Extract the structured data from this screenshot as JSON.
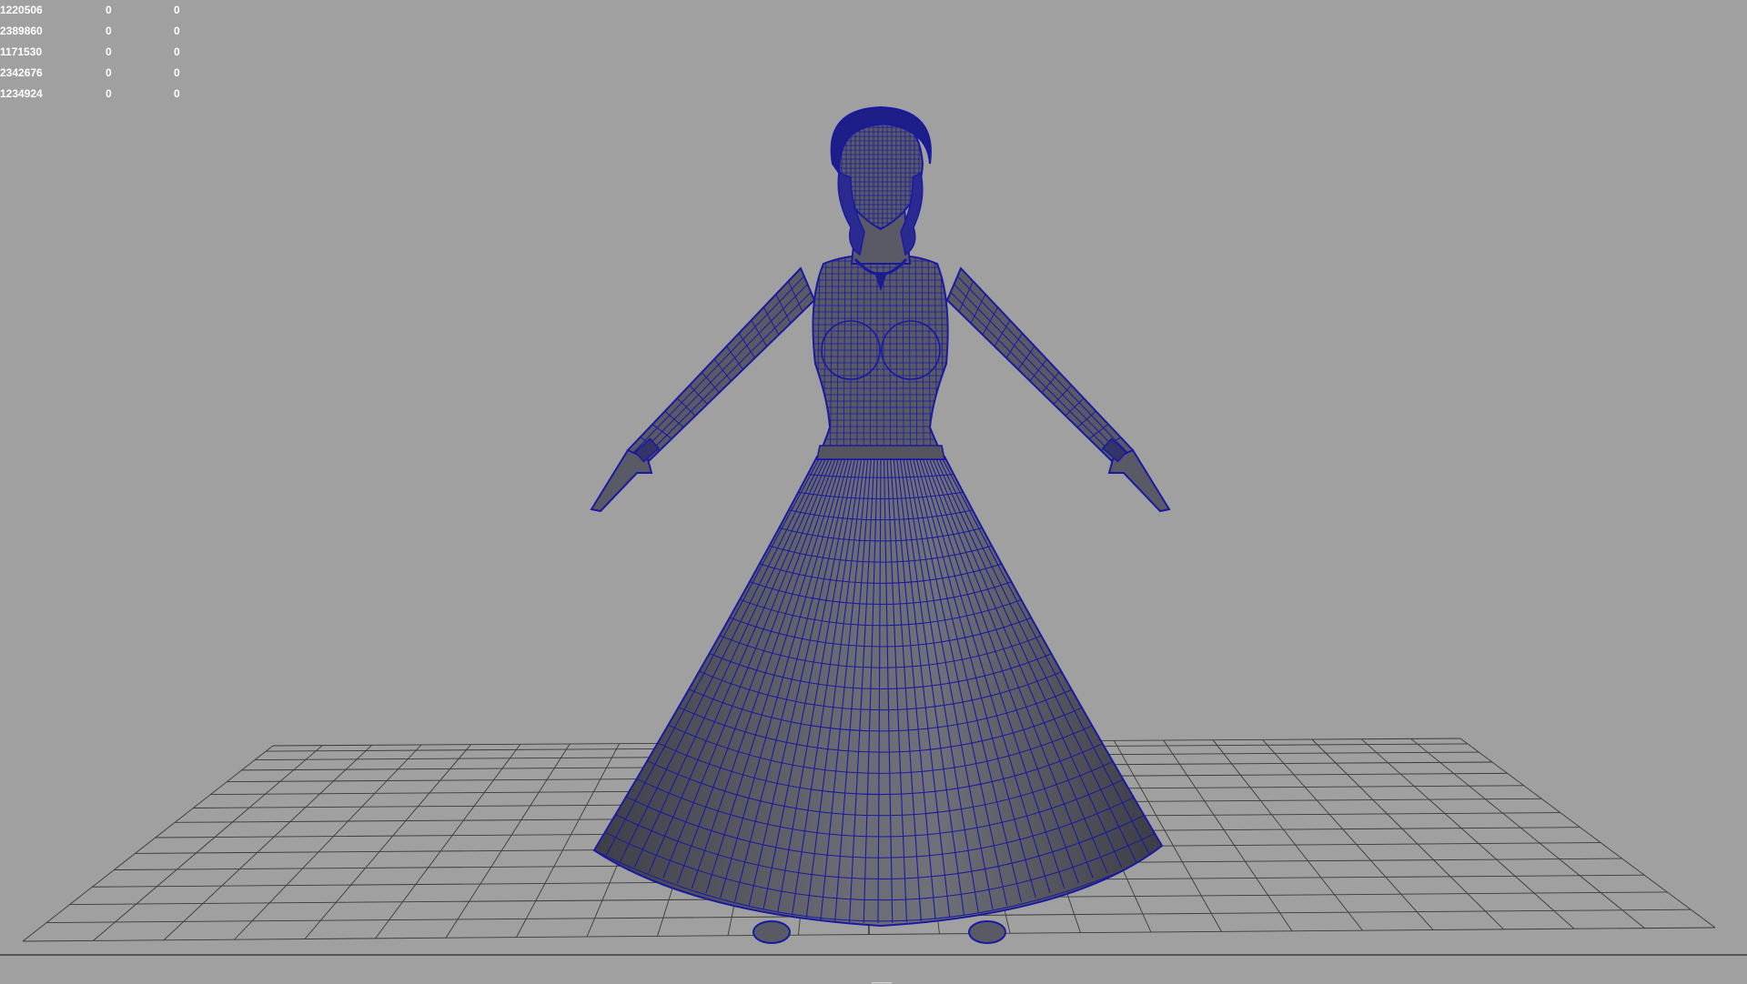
{
  "viewport": {
    "background_color": "#a0a0a0",
    "grid_color": "#3a3a3a",
    "wireframe_color": "#1a1aa0",
    "mesh_fill_color": "#5a5a66",
    "origin_label": "____"
  },
  "hud": {
    "rows": [
      [
        "1220506",
        "0",
        "0"
      ],
      [
        "2389860",
        "0",
        "0"
      ],
      [
        "1171530",
        "0",
        "0"
      ],
      [
        "2342676",
        "0",
        "0"
      ],
      [
        "1234924",
        "0",
        "0"
      ]
    ]
  },
  "model": {
    "icon": "character-mesh-wireframe",
    "pose": "A-pose",
    "garment": "long flared gown"
  }
}
